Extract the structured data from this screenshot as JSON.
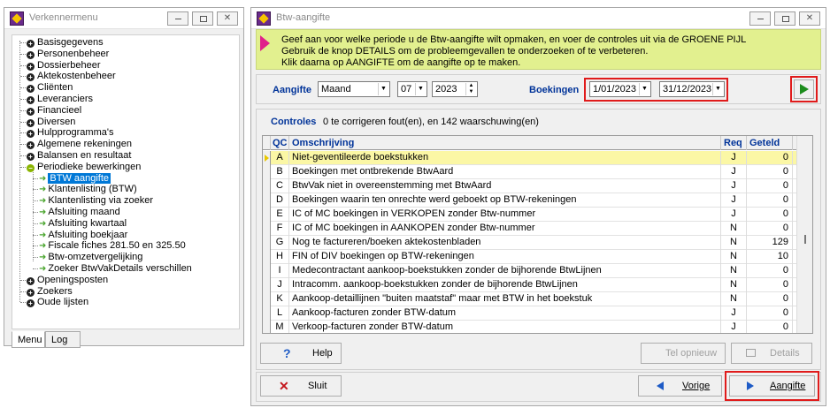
{
  "left_window": {
    "title": "Verkennermenu",
    "tree": [
      {
        "label": "Basisgegevens",
        "type": "plus"
      },
      {
        "label": "Personenbeheer",
        "type": "plus"
      },
      {
        "label": "Dossierbeheer",
        "type": "plus"
      },
      {
        "label": "Aktekostenbeheer",
        "type": "plus"
      },
      {
        "label": "Cliënten",
        "type": "plus"
      },
      {
        "label": "Leveranciers",
        "type": "plus"
      },
      {
        "label": "Financieel",
        "type": "plus"
      },
      {
        "label": "Diversen",
        "type": "plus"
      },
      {
        "label": "Hulpprogramma's",
        "type": "plus"
      },
      {
        "label": "Algemene rekeningen",
        "type": "plus"
      },
      {
        "label": "Balansen en resultaat",
        "type": "plus"
      },
      {
        "label": "Periodieke bewerkingen",
        "type": "open"
      },
      {
        "label": "BTW aangifte",
        "type": "child",
        "selected": true
      },
      {
        "label": "Klantenlisting (BTW)",
        "type": "child"
      },
      {
        "label": "Klantenlisting via zoeker",
        "type": "child"
      },
      {
        "label": "Afsluiting maand",
        "type": "child"
      },
      {
        "label": "Afsluiting kwartaal",
        "type": "child"
      },
      {
        "label": "Afsluiting boekjaar",
        "type": "child"
      },
      {
        "label": "Fiscale fiches 281.50 en 325.50",
        "type": "child"
      },
      {
        "label": "Btw-omzetvergelijking",
        "type": "child"
      },
      {
        "label": "Zoeker BtwVakDetails verschillen",
        "type": "child"
      },
      {
        "label": "Openingsposten",
        "type": "plus"
      },
      {
        "label": "Zoekers",
        "type": "plus"
      },
      {
        "label": "Oude lijsten",
        "type": "plus"
      }
    ],
    "tabs": [
      "Menu",
      "Log"
    ]
  },
  "right_window": {
    "title": "Btw-aangifte",
    "info_lines": [
      "Geef aan voor welke periode u de Btw-aangifte wilt opmaken, en voer de controles uit via de GROENE PIJL",
      "Gebruik de knop DETAILS om de probleemgevallen te onderzoeken of te verbeteren.",
      "Klik daarna op AANGIFTE om de aangifte op te maken."
    ],
    "aangifte_label": "Aangifte",
    "period_type": "Maand",
    "month": "07",
    "year": "2023",
    "boekingen_label": "Boekingen",
    "date_from": "1/01/2023",
    "date_to": "31/12/2023",
    "controles_label": "Controles",
    "controles_summary": "0 te corrigeren fout(en), en 142 waarschuwing(en)",
    "grid_headers": {
      "qc": "QC",
      "omschrijving": "Omschrijving",
      "req": "Req",
      "geteld": "Geteld"
    },
    "rows": [
      {
        "qc": "A",
        "omschrijving": "Niet-geventileerde boekstukken",
        "req": "J",
        "geteld": "0"
      },
      {
        "qc": "B",
        "omschrijving": "Boekingen met ontbrekende BtwAard",
        "req": "J",
        "geteld": "0"
      },
      {
        "qc": "C",
        "omschrijving": "BtwVak niet in overeenstemming met BtwAard",
        "req": "J",
        "geteld": "0"
      },
      {
        "qc": "D",
        "omschrijving": "Boekingen waarin ten onrechte werd geboekt op BTW-rekeningen",
        "req": "J",
        "geteld": "0"
      },
      {
        "qc": "E",
        "omschrijving": "IC of MC boekingen in VERKOPEN zonder Btw-nummer",
        "req": "J",
        "geteld": "0"
      },
      {
        "qc": "F",
        "omschrijving": "IC of MC boekingen in AANKOPEN zonder Btw-nummer",
        "req": "N",
        "geteld": "0"
      },
      {
        "qc": "G",
        "omschrijving": "Nog te factureren/boeken aktekostenbladen",
        "req": "N",
        "geteld": "129"
      },
      {
        "qc": "H",
        "omschrijving": "FIN of DIV boekingen op BTW-rekeningen",
        "req": "N",
        "geteld": "10"
      },
      {
        "qc": "I",
        "omschrijving": "Medecontractant aankoop-boekstukken zonder de bijhorende BtwLijnen",
        "req": "N",
        "geteld": "0"
      },
      {
        "qc": "J",
        "omschrijving": "Intracomm. aankoop-boekstukken zonder de bijhorende BtwLijnen",
        "req": "N",
        "geteld": "0"
      },
      {
        "qc": "K",
        "omschrijving": "Aankoop-detaillijnen \"buiten maatstaf\" maar met BTW in het boekstuk",
        "req": "N",
        "geteld": "0"
      },
      {
        "qc": "L",
        "omschrijving": "Aankoop-facturen zonder BTW-datum",
        "req": "J",
        "geteld": "0"
      },
      {
        "qc": "M",
        "omschrijving": "Verkoop-facturen zonder BTW-datum",
        "req": "J",
        "geteld": "0"
      }
    ],
    "buttons": {
      "help": "Help",
      "tel_opnieuw": "Tel opnieuw",
      "details": "Details",
      "sluit": "Sluit",
      "vorige": "Vorige",
      "aangifte": "Aangifte"
    }
  }
}
